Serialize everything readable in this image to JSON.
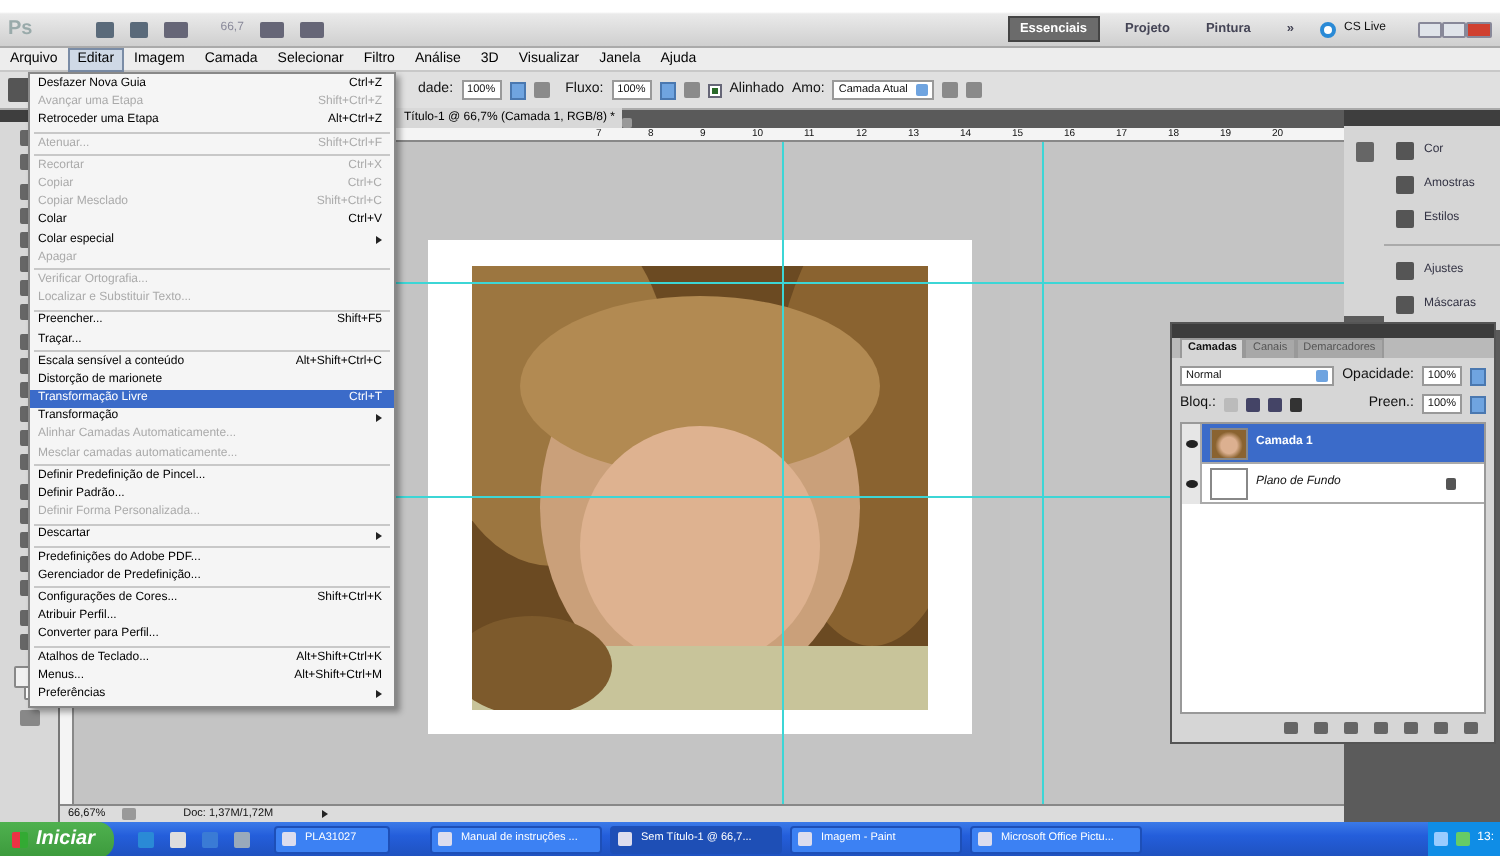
{
  "app_bar": {
    "logo": "Ps",
    "zoom": "66,7",
    "workspaces": [
      {
        "label": "Essenciais",
        "selected": true
      },
      {
        "label": "Projeto",
        "selected": false
      },
      {
        "label": "Pintura",
        "selected": false
      }
    ],
    "more": "»",
    "cs_live": "CS Live"
  },
  "menu_bar": [
    {
      "label": "Arquivo",
      "selected": false
    },
    {
      "label": "Editar",
      "selected": true
    },
    {
      "label": "Imagem",
      "selected": false
    },
    {
      "label": "Camada",
      "selected": false
    },
    {
      "label": "Selecionar",
      "selected": false
    },
    {
      "label": "Filtro",
      "selected": false
    },
    {
      "label": "Análise",
      "selected": false
    },
    {
      "label": "3D",
      "selected": false
    },
    {
      "label": "Visualizar",
      "selected": false
    },
    {
      "label": "Janela",
      "selected": false
    },
    {
      "label": "Ajuda",
      "selected": false
    }
  ],
  "options_bar": {
    "opacity_label": "dade:",
    "opacity": "100%",
    "flow_label": "Fluxo:",
    "flow": "100%",
    "aligned_label": "Alinhado",
    "aligned": true,
    "sample_label": "Amo:",
    "sample": "Camada Atual"
  },
  "document": {
    "tab": "Título-1 @ 66,7% (Camada 1, RGB/8) *",
    "ruler": [
      "7",
      "8",
      "9",
      "10",
      "11",
      "12",
      "13",
      "14",
      "15",
      "16",
      "17",
      "18",
      "19",
      "20"
    ]
  },
  "edit_menu": [
    {
      "kind": "item",
      "label": "Desfazer Nova Guia",
      "shortcut": "Ctrl+Z",
      "disabled": false,
      "selected": false
    },
    {
      "kind": "item",
      "label": "Avançar uma Etapa",
      "shortcut": "Shift+Ctrl+Z",
      "disabled": true,
      "selected": false
    },
    {
      "kind": "item",
      "label": "Retroceder uma Etapa",
      "shortcut": "Alt+Ctrl+Z",
      "disabled": false,
      "selected": false
    },
    {
      "kind": "separator"
    },
    {
      "kind": "item",
      "label": "Atenuar...",
      "shortcut": "Shift+Ctrl+F",
      "disabled": true,
      "selected": false
    },
    {
      "kind": "separator"
    },
    {
      "kind": "item",
      "label": "Recortar",
      "shortcut": "Ctrl+X",
      "disabled": true,
      "selected": false
    },
    {
      "kind": "item",
      "label": "Copiar",
      "shortcut": "Ctrl+C",
      "disabled": true,
      "selected": false
    },
    {
      "kind": "item",
      "label": "Copiar Mesclado",
      "shortcut": "Shift+Ctrl+C",
      "disabled": true,
      "selected": false
    },
    {
      "kind": "item",
      "label": "Colar",
      "shortcut": "Ctrl+V",
      "disabled": false,
      "selected": false
    },
    {
      "kind": "item",
      "label": "Colar especial",
      "submenu": true,
      "disabled": false,
      "selected": false
    },
    {
      "kind": "item",
      "label": "Apagar",
      "disabled": true,
      "selected": false
    },
    {
      "kind": "separator"
    },
    {
      "kind": "item",
      "label": "Verificar Ortografia...",
      "disabled": true,
      "selected": false
    },
    {
      "kind": "item",
      "label": "Localizar e Substituir Texto...",
      "disabled": true,
      "selected": false
    },
    {
      "kind": "separator"
    },
    {
      "kind": "item",
      "label": "Preencher...",
      "shortcut": "Shift+F5",
      "disabled": false,
      "selected": false
    },
    {
      "kind": "item",
      "label": "Traçar...",
      "disabled": false,
      "selected": false
    },
    {
      "kind": "separator"
    },
    {
      "kind": "item",
      "label": "Escala sensível a conteúdo",
      "shortcut": "Alt+Shift+Ctrl+C",
      "disabled": false,
      "selected": false
    },
    {
      "kind": "item",
      "label": "Distorção de marionete",
      "disabled": false,
      "selected": false
    },
    {
      "kind": "item",
      "label": "Transformação Livre",
      "shortcut": "Ctrl+T",
      "disabled": false,
      "selected": true
    },
    {
      "kind": "item",
      "label": "Transformação",
      "submenu": true,
      "disabled": false,
      "selected": false
    },
    {
      "kind": "item",
      "label": "Alinhar Camadas Automaticamente...",
      "disabled": true,
      "selected": false
    },
    {
      "kind": "item",
      "label": "Mesclar camadas automaticamente...",
      "disabled": true,
      "selected": false
    },
    {
      "kind": "separator"
    },
    {
      "kind": "item",
      "label": "Definir Predefinição de Pincel...",
      "disabled": false,
      "selected": false
    },
    {
      "kind": "item",
      "label": "Definir Padrão...",
      "disabled": false,
      "selected": false
    },
    {
      "kind": "item",
      "label": "Definir Forma Personalizada...",
      "disabled": true,
      "selected": false
    },
    {
      "kind": "separator"
    },
    {
      "kind": "item",
      "label": "Descartar",
      "submenu": true,
      "disabled": false,
      "selected": false
    },
    {
      "kind": "separator"
    },
    {
      "kind": "item",
      "label": "Predefinições do Adobe PDF...",
      "disabled": false,
      "selected": false
    },
    {
      "kind": "item",
      "label": "Gerenciador de Predefinição...",
      "disabled": false,
      "selected": false
    },
    {
      "kind": "separator"
    },
    {
      "kind": "item",
      "label": "Configurações de Cores...",
      "shortcut": "Shift+Ctrl+K",
      "disabled": false,
      "selected": false
    },
    {
      "kind": "item",
      "label": "Atribuir Perfil...",
      "disabled": false,
      "selected": false
    },
    {
      "kind": "item",
      "label": "Converter para Perfil...",
      "disabled": false,
      "selected": false
    },
    {
      "kind": "separator"
    },
    {
      "kind": "item",
      "label": "Atalhos de Teclado...",
      "shortcut": "Alt+Shift+Ctrl+K",
      "disabled": false,
      "selected": false
    },
    {
      "kind": "item",
      "label": "Menus...",
      "shortcut": "Alt+Shift+Ctrl+M",
      "disabled": false,
      "selected": false
    },
    {
      "kind": "item",
      "label": "Preferências",
      "submenu": true,
      "disabled": false,
      "selected": false
    }
  ],
  "dock": {
    "groups": [
      [
        "Cor",
        "Amostras",
        "Estilos"
      ],
      [
        "Ajustes",
        "Máscaras"
      ]
    ]
  },
  "layers_panel": {
    "tabs": [
      {
        "label": "Camadas",
        "selected": true
      },
      {
        "label": "Canais",
        "selected": false
      },
      {
        "label": "Demarcadores",
        "selected": false
      }
    ],
    "blend_mode": "Normal",
    "opacity_label": "Opacidade:",
    "opacity": "100%",
    "lock_label": "Bloq.:",
    "fill_label": "Preen.:",
    "fill": "100%",
    "layers": [
      {
        "name": "Camada 1",
        "selected": true,
        "visible": true,
        "locked": false
      },
      {
        "name": "Plano de Fundo",
        "kind": "background",
        "selected": false,
        "visible": true,
        "locked": true
      }
    ]
  },
  "status_bar": {
    "zoom": "66,67%",
    "doc": "Doc: 1,37M/1,72M"
  },
  "taskbar": {
    "start": "Iniciar",
    "tasks": [
      {
        "label": "PLA31027",
        "selected": false
      },
      {
        "label": "Manual de instruções ...",
        "selected": false
      },
      {
        "label": "Sem Título-1 @ 66,7...",
        "selected": true
      },
      {
        "label": "Imagem - Paint",
        "selected": false
      },
      {
        "label": "Microsoft Office Pictu...",
        "selected": false
      }
    ],
    "clock": "13:"
  }
}
